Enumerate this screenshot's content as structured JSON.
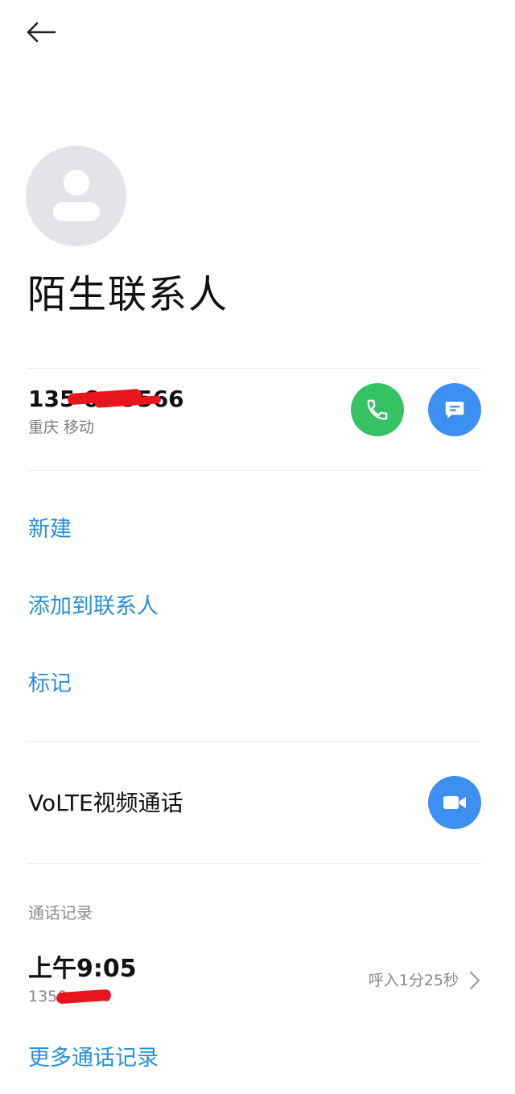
{
  "contact": {
    "name": "陌生联系人",
    "phone_number": "135 6      9566",
    "location": "重庆 移动"
  },
  "actions": [
    {
      "label": "新建"
    },
    {
      "label": "添加到联系人"
    },
    {
      "label": "标记"
    }
  ],
  "volte": {
    "label": "VoLTE视频通话"
  },
  "call_log": {
    "section_title": "通话记录",
    "records": [
      {
        "time": "上午9:05",
        "number": "1350      566",
        "detail": "呼入1分25秒"
      }
    ],
    "more_label": "更多通话记录"
  },
  "colors": {
    "accent_blue": "#2a8fd9",
    "call_green": "#34c265",
    "button_blue": "#3d8ff2",
    "redaction_red": "#e8151f"
  },
  "icons": {
    "back": "arrow-left-icon",
    "avatar": "person-icon",
    "call": "phone-icon",
    "message": "message-icon",
    "video": "video-camera-icon",
    "chevron": "chevron-right-icon"
  }
}
